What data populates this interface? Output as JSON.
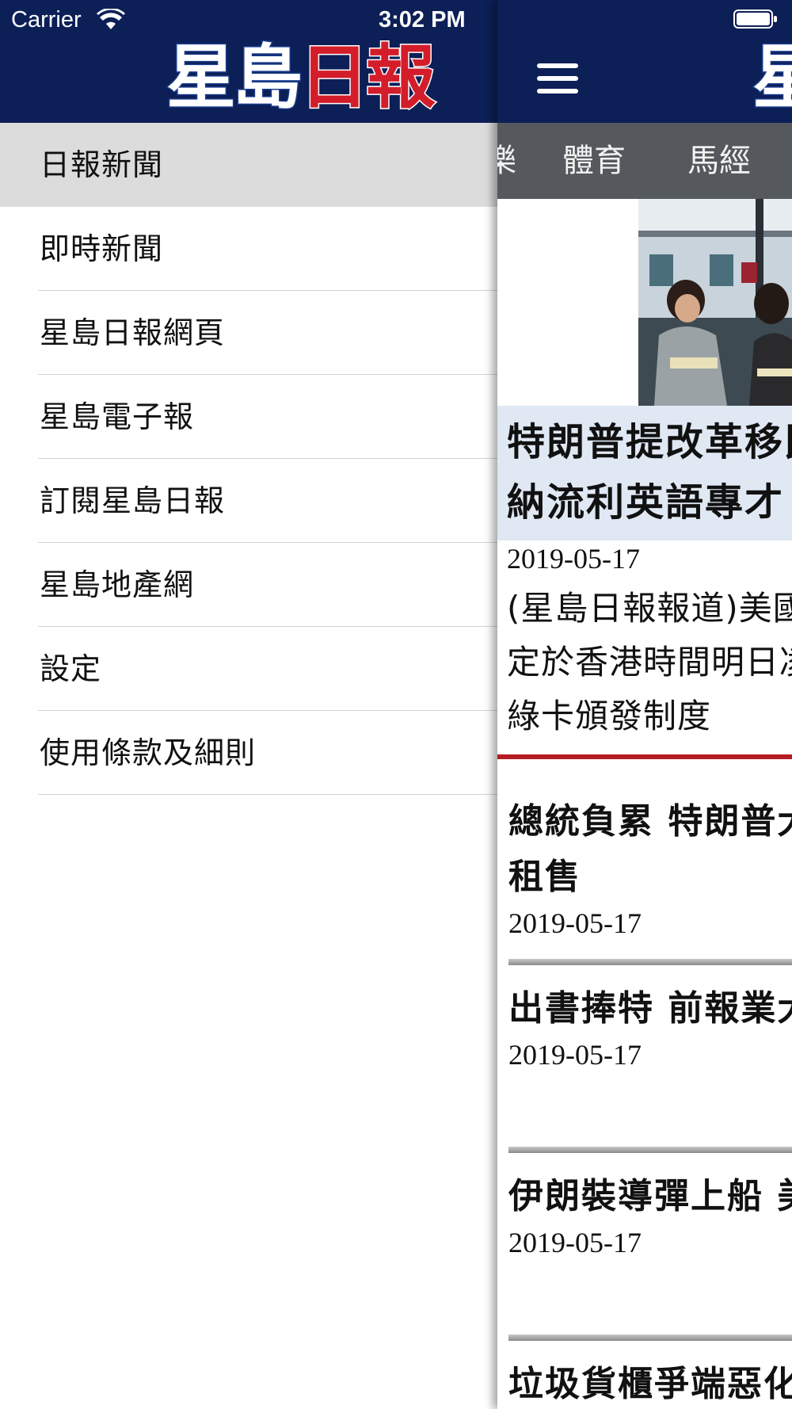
{
  "status_bar": {
    "carrier": "Carrier",
    "time": "3:02 PM"
  },
  "drawer": {
    "logo": {
      "part1": "星島",
      "part2": "日報"
    },
    "items": [
      {
        "label": "日報新聞",
        "active": true
      },
      {
        "label": "即時新聞"
      },
      {
        "label": "星島日報網頁"
      },
      {
        "label": "星島電子報"
      },
      {
        "label": "訂閱星島日報"
      },
      {
        "label": "星島地產網"
      },
      {
        "label": "設定"
      },
      {
        "label": "使用條款及細則"
      }
    ]
  },
  "panel": {
    "logo_peek": "星",
    "tabs": {
      "prev": "樂",
      "sports": "體育",
      "racing": "馬經"
    },
    "hero": {
      "title": "特朗普提改革移民制度 吸納流利英語專才",
      "date": "2019-05-17",
      "body": "(星島日報報道)美國總統特朗普定於香港時間明日凌晨，改革綠卡頒發制度"
    },
    "articles": [
      {
        "title": "總統負累 特朗普大廈單位難租售",
        "date": "2019-05-17"
      },
      {
        "title": "出書捧特 前報業大亨獲特赦",
        "date": "2019-05-17"
      },
      {
        "title": "伊朗裝導彈上船 美增兵中東",
        "date": "2019-05-17"
      },
      {
        "title": "垃圾貨櫃爭端惡化",
        "date": ""
      }
    ]
  },
  "colors": {
    "navy": "#0c1f57",
    "tabbar": "#55595d",
    "accent_red": "#b71b23",
    "active_row": "#dcdcdc"
  }
}
